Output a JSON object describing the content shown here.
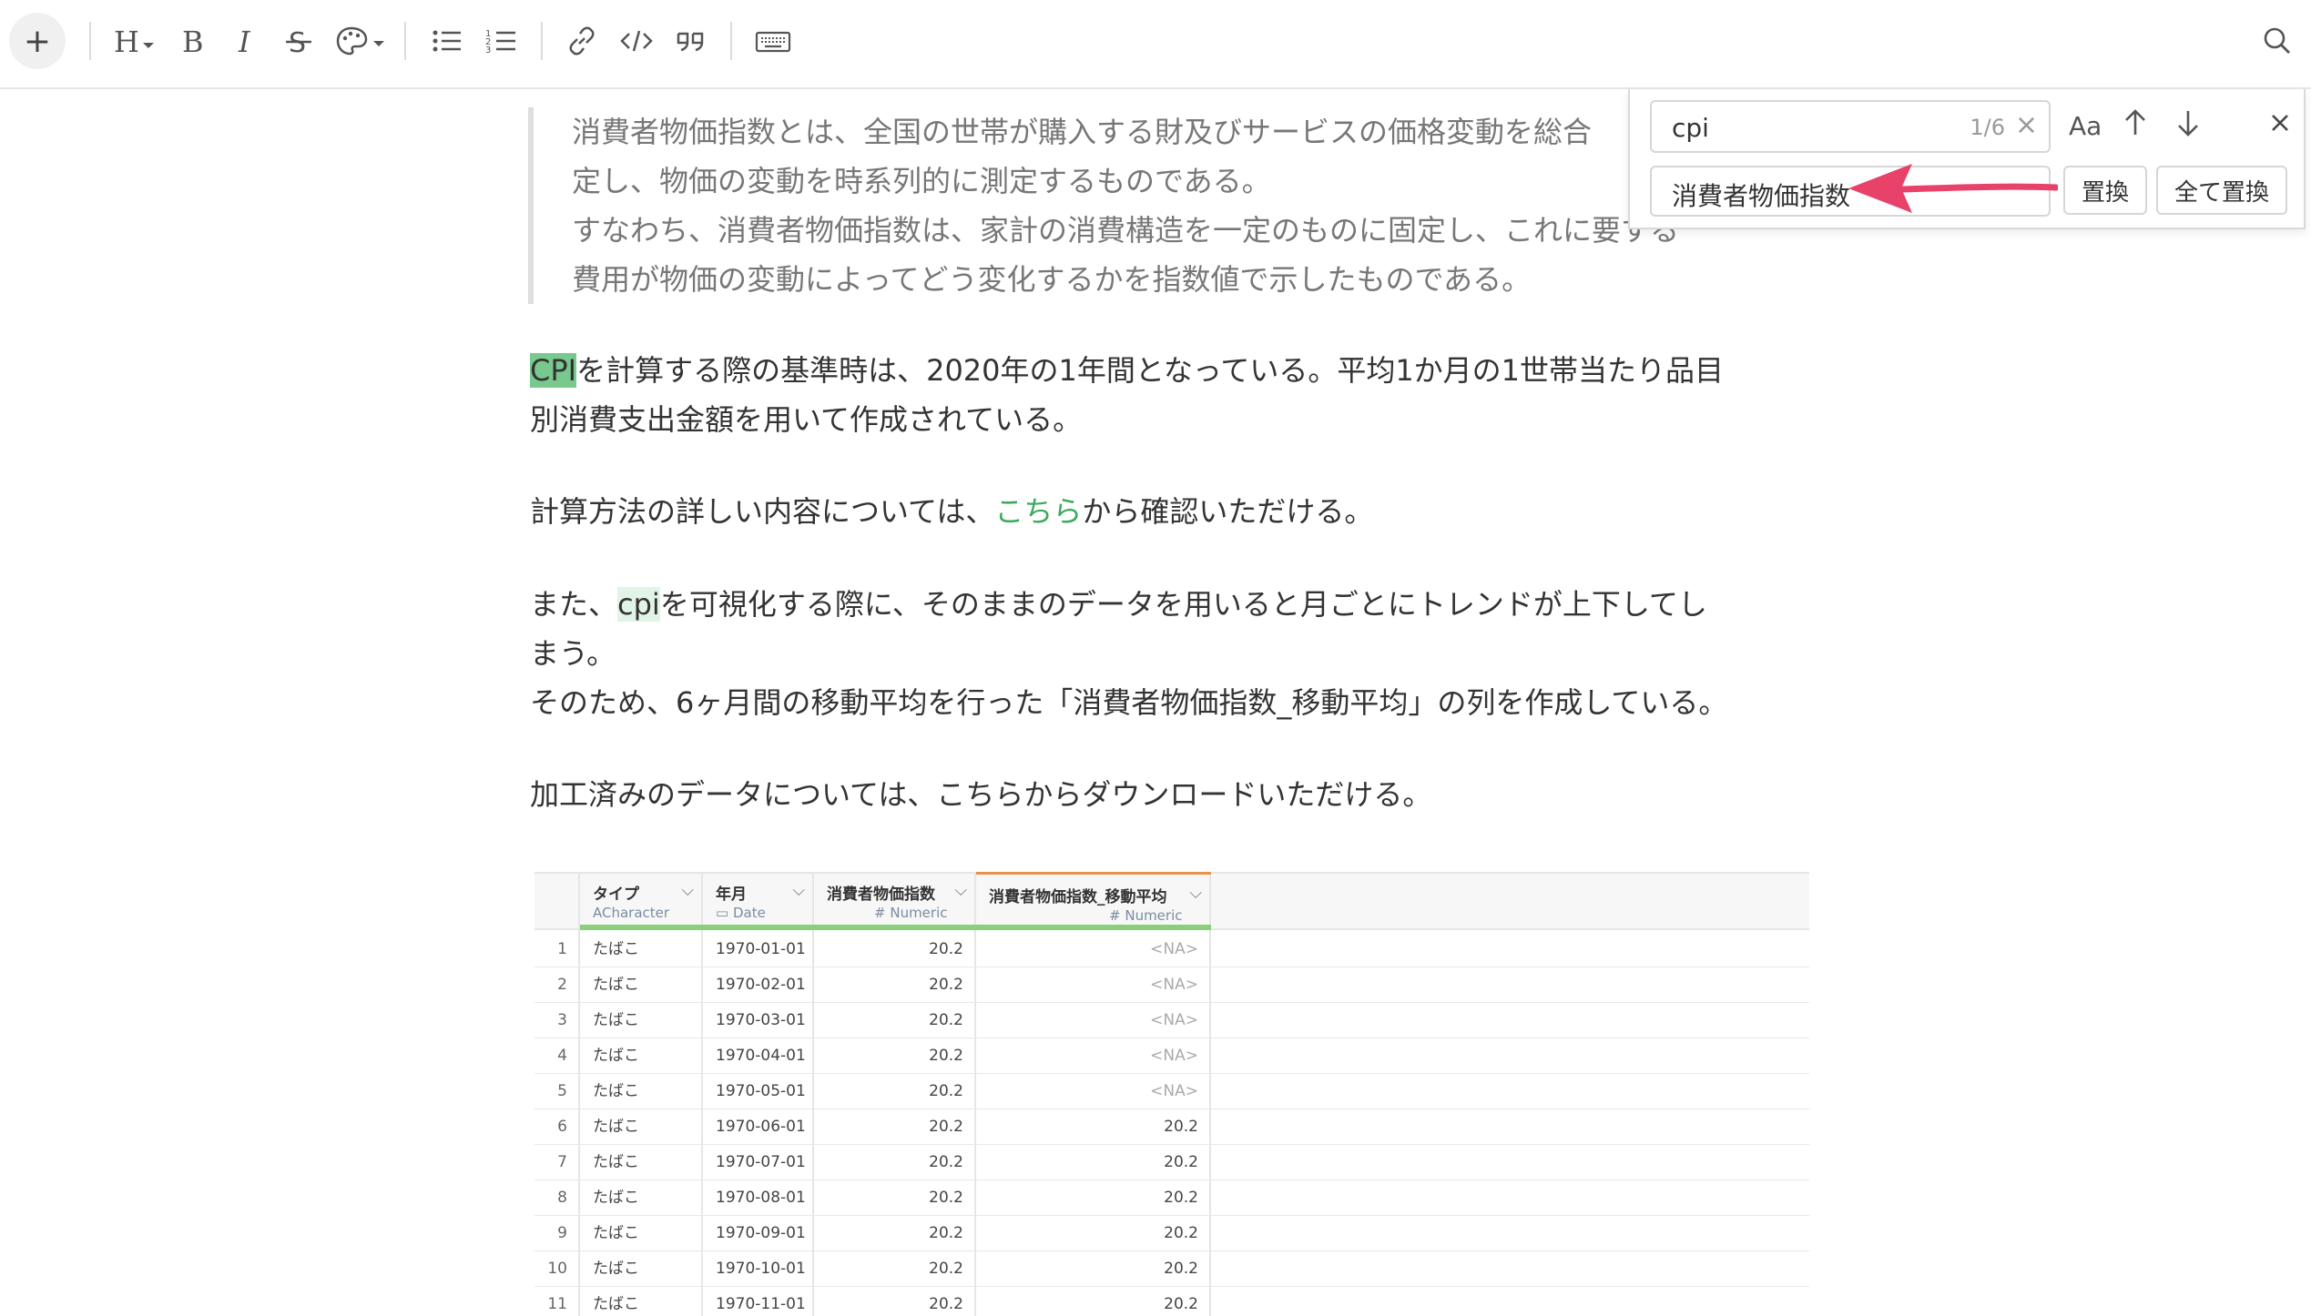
{
  "toolbar": {
    "items": [
      "plus",
      "heading",
      "bold",
      "italic",
      "strikethrough",
      "color-palette",
      "bullet-list",
      "numbered-list",
      "link",
      "code",
      "quote",
      "keyboard",
      "search"
    ]
  },
  "quote": {
    "lines": [
      "消費者物価指数とは、全国の世帯が購入する財及びサービスの価格変動を総合",
      "定し、物価の変動を時系列的に測定するものである。",
      "すなわち、消費者物価指数は、家計の消費構造を一定のものに固定し、これに要する",
      "費用が物価の変動によってどう変化するかを指数値で示したものである。"
    ]
  },
  "body": {
    "p1": {
      "match": "CPI",
      "rest_line1": "を計算する際の基準時は、2020年の1年間となっている。平均1か月の1世帯当たり品目",
      "line2": "別消費支出金額を用いて作成されている。"
    },
    "p2": {
      "before": "計算方法の詳しい内容については、",
      "link": "こちら",
      "after": "から確認いただける。"
    },
    "p3": {
      "before": "また、",
      "match": "cpi",
      "after": "を可視化する際に、そのままのデータを用いると月ごとにトレンドが上下してし",
      "line2": "まう。",
      "line3": "そのため、6ヶ月間の移動平均を行った「消費者物価指数_移動平均」の列を作成している。"
    },
    "p4": "加工済みのデータについては、こちらからダウンロードいただける。"
  },
  "search_panel": {
    "query": "cpi",
    "count": "1/6",
    "case_label": "Aa",
    "replace_value": "消費者物価指数",
    "replace_button": "置換",
    "replace_all_button": "全て置換",
    "accent_color": "#e8416a"
  },
  "table": {
    "columns": [
      {
        "name": "タイプ",
        "type": "Character",
        "type_icon": "A"
      },
      {
        "name": "年月",
        "type": "Date",
        "type_icon": "calendar"
      },
      {
        "name": "消費者物価指数",
        "type": "Numeric",
        "type_icon": "#"
      },
      {
        "name": "消費者物価指数_移動平均",
        "type": "Numeric",
        "type_icon": "#"
      }
    ],
    "rows": [
      [
        "1",
        "たばこ",
        "1970-01-01",
        "20.2",
        "<NA>"
      ],
      [
        "2",
        "たばこ",
        "1970-02-01",
        "20.2",
        "<NA>"
      ],
      [
        "3",
        "たばこ",
        "1970-03-01",
        "20.2",
        "<NA>"
      ],
      [
        "4",
        "たばこ",
        "1970-04-01",
        "20.2",
        "<NA>"
      ],
      [
        "5",
        "たばこ",
        "1970-05-01",
        "20.2",
        "<NA>"
      ],
      [
        "6",
        "たばこ",
        "1970-06-01",
        "20.2",
        "20.2"
      ],
      [
        "7",
        "たばこ",
        "1970-07-01",
        "20.2",
        "20.2"
      ],
      [
        "8",
        "たばこ",
        "1970-08-01",
        "20.2",
        "20.2"
      ],
      [
        "9",
        "たばこ",
        "1970-09-01",
        "20.2",
        "20.2"
      ],
      [
        "10",
        "たばこ",
        "1970-10-01",
        "20.2",
        "20.2"
      ],
      [
        "11",
        "たばこ",
        "1970-11-01",
        "20.2",
        "20.2"
      ]
    ]
  }
}
